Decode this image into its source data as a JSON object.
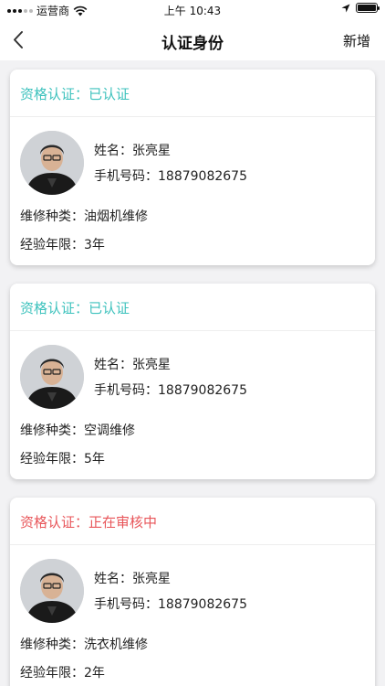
{
  "status_bar": {
    "carrier": "运营商",
    "time": "上午 10:43",
    "icons": [
      "signal-icon",
      "wifi-icon",
      "location-arrow-icon",
      "battery-icon"
    ]
  },
  "nav": {
    "back_icon": "chevron-left-icon",
    "title": "认证身份",
    "action_label": "新增"
  },
  "labels": {
    "qualification": "资格认证：",
    "name": "姓名：",
    "phone": "手机号码：",
    "repair_type": "维修种类：",
    "experience": "经验年限："
  },
  "colors": {
    "verified": "#3dc2bd",
    "pending": "#e8565a"
  },
  "cards": [
    {
      "status": "已认证",
      "status_kind": "verified",
      "name": "张亮星",
      "phone": "18879082675",
      "repair_type": "油烟机维修",
      "experience": "3年"
    },
    {
      "status": "已认证",
      "status_kind": "verified",
      "name": "张亮星",
      "phone": "18879082675",
      "repair_type": "空调维修",
      "experience": "5年"
    },
    {
      "status": "正在审核中",
      "status_kind": "pending",
      "name": "张亮星",
      "phone": "18879082675",
      "repair_type": "洗衣机维修",
      "experience": "2年"
    }
  ]
}
